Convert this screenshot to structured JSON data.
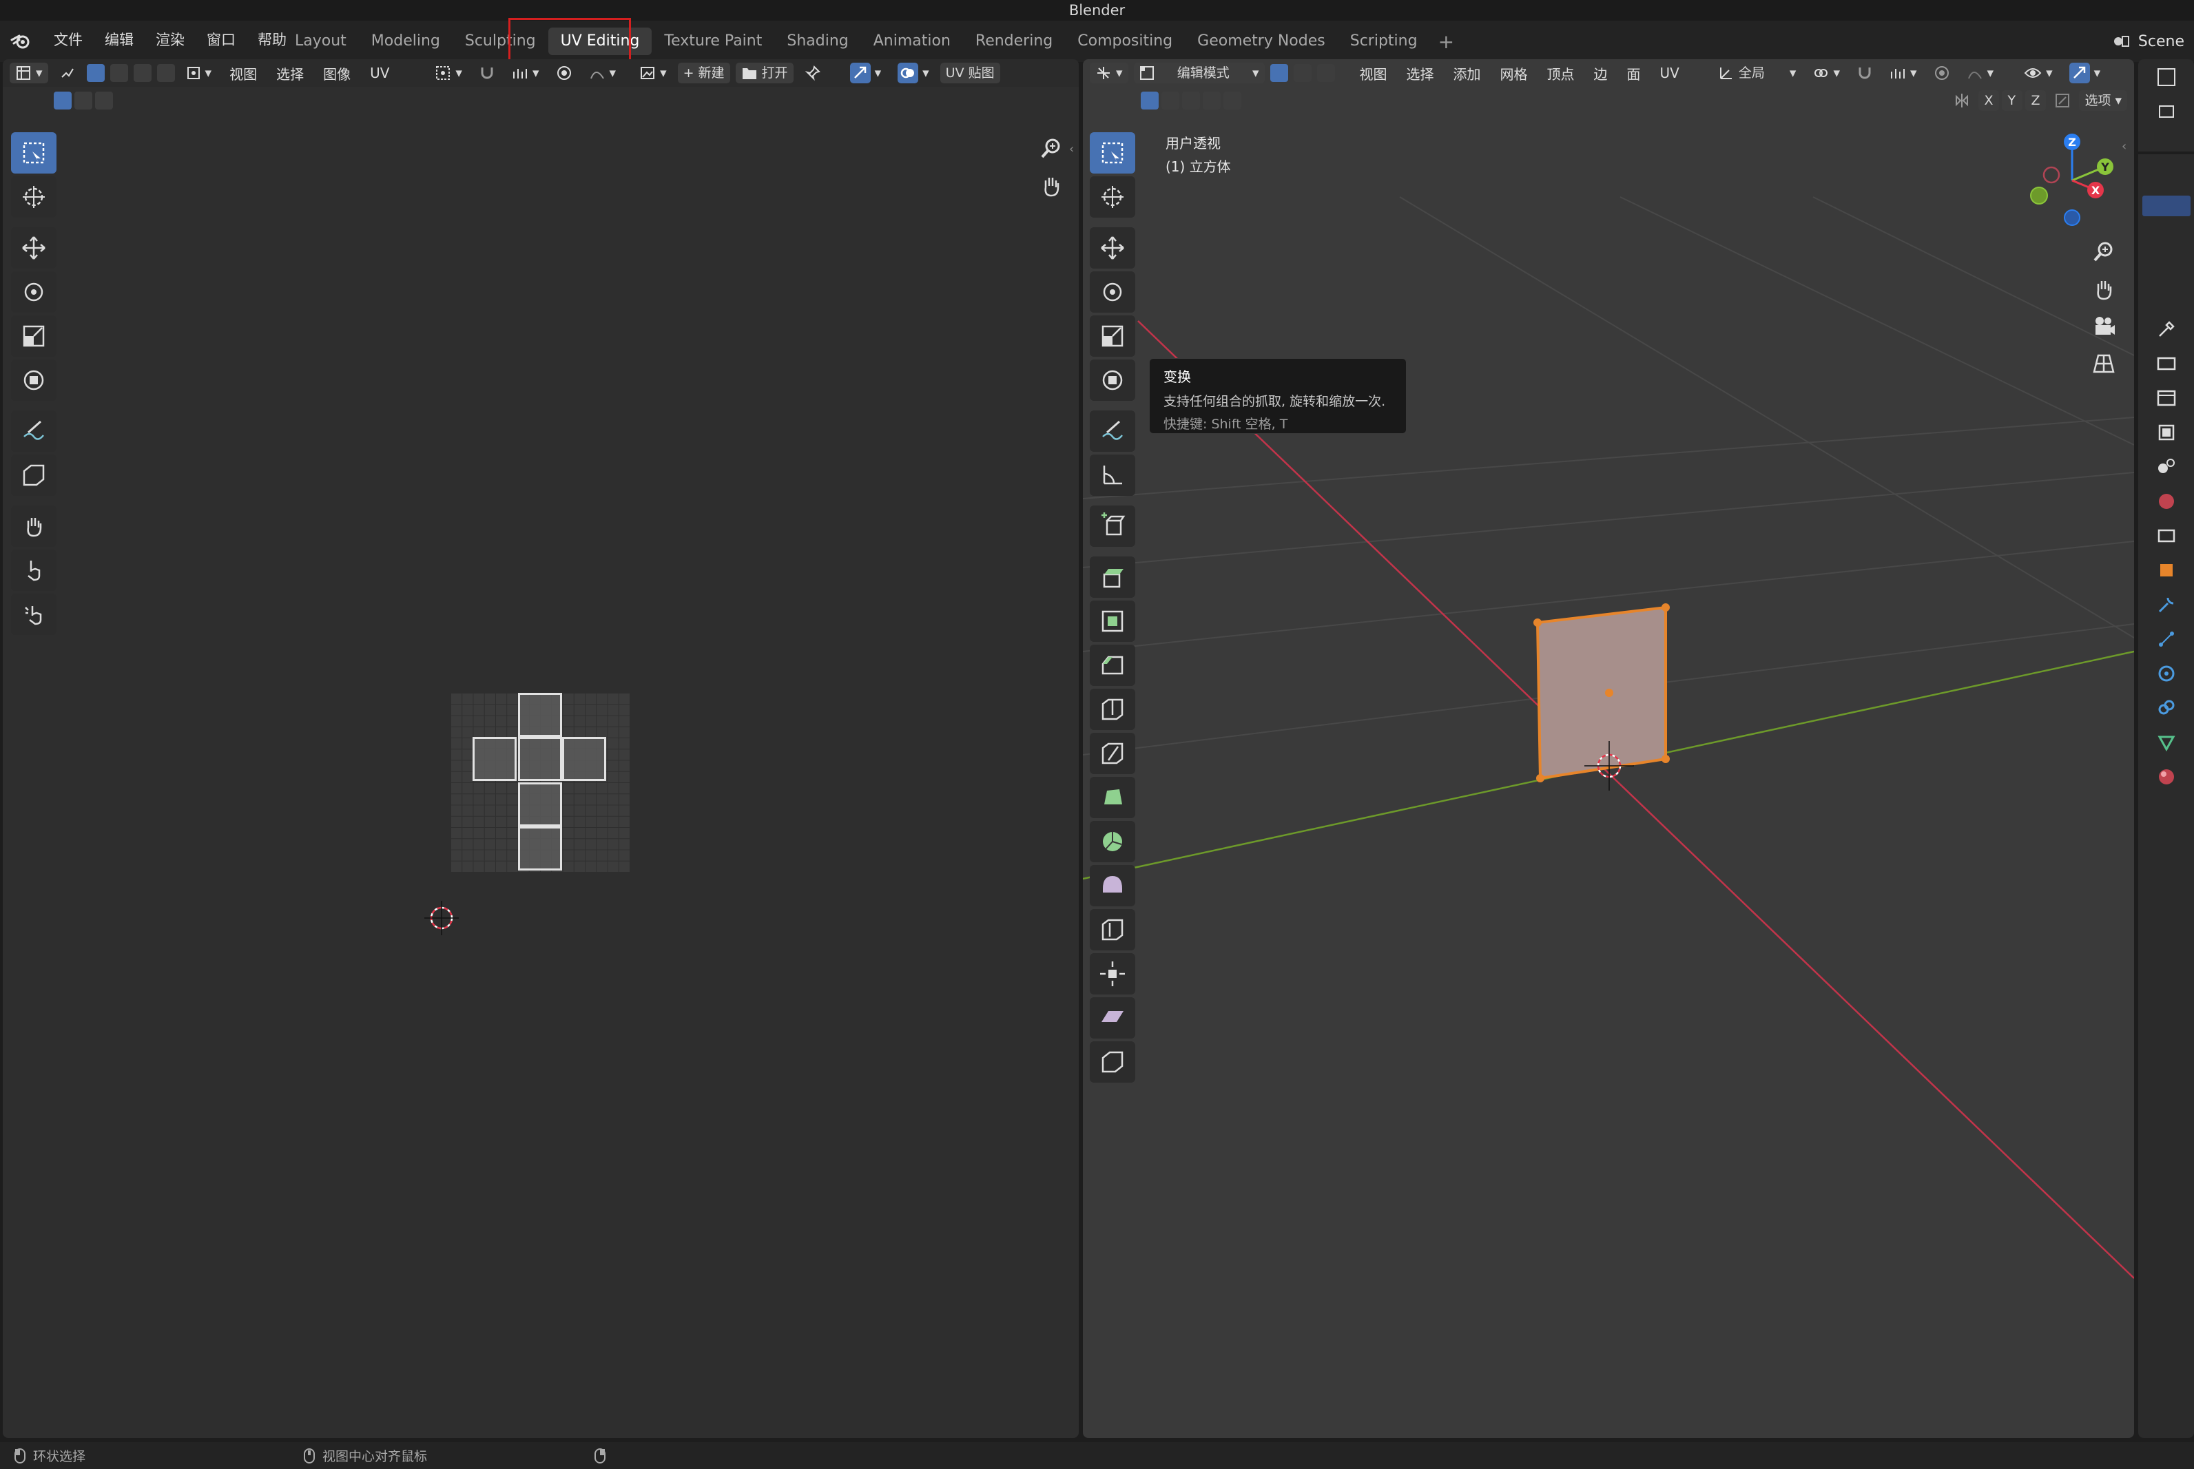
{
  "window": {
    "title": "Blender"
  },
  "menu": [
    {
      "id": "file",
      "label": "文件"
    },
    {
      "id": "edit",
      "label": "编辑"
    },
    {
      "id": "render",
      "label": "渲染"
    },
    {
      "id": "window",
      "label": "窗口"
    },
    {
      "id": "help",
      "label": "帮助"
    }
  ],
  "workspaces": [
    {
      "id": "layout",
      "label": "Layout"
    },
    {
      "id": "modeling",
      "label": "Modeling"
    },
    {
      "id": "sculpting",
      "label": "Sculpting"
    },
    {
      "id": "uv-editing",
      "label": "UV Editing",
      "active": true
    },
    {
      "id": "texture-paint",
      "label": "Texture Paint"
    },
    {
      "id": "shading",
      "label": "Shading"
    },
    {
      "id": "animation",
      "label": "Animation"
    },
    {
      "id": "rendering",
      "label": "Rendering"
    },
    {
      "id": "compositing",
      "label": "Compositing"
    },
    {
      "id": "geometry-nodes",
      "label": "Geometry Nodes"
    },
    {
      "id": "scripting",
      "label": "Scripting"
    }
  ],
  "scene": {
    "label": "Scene"
  },
  "uv_editor": {
    "menus": [
      {
        "id": "view",
        "label": "视图"
      },
      {
        "id": "select",
        "label": "选择"
      },
      {
        "id": "image",
        "label": "图像"
      },
      {
        "id": "uv",
        "label": "UV"
      }
    ],
    "new_label": "新建",
    "open_label": "打开",
    "uvmap_label": "UV 贴图"
  },
  "viewport": {
    "mode_label": "编辑模式",
    "menus": [
      {
        "id": "view",
        "label": "视图"
      },
      {
        "id": "select",
        "label": "选择"
      },
      {
        "id": "add",
        "label": "添加"
      },
      {
        "id": "mesh",
        "label": "网格"
      },
      {
        "id": "vertex",
        "label": "顶点"
      },
      {
        "id": "edge",
        "label": "边"
      },
      {
        "id": "face",
        "label": "面"
      },
      {
        "id": "uv",
        "label": "UV"
      }
    ],
    "orientation_label": "全局",
    "options_label": "选项",
    "axis_x": "X",
    "axis_y": "Y",
    "axis_z": "Z",
    "overlay_title": "用户透视",
    "overlay_object": "(1) 立方体",
    "gizmo": {
      "x": "X",
      "y": "Y",
      "z": "Z"
    }
  },
  "tooltip": {
    "title": "变换",
    "description": "支持任何组合的抓取, 旋转和缩放一次.",
    "shortcut": "快捷键: Shift 空格, T"
  },
  "statusbar": {
    "left": "环状选择",
    "middle": "视图中心对齐鼠标"
  },
  "colors": {
    "accent": "#4772b3",
    "highlight": "#d41f1f",
    "x_axis": "#e5364a",
    "y_axis": "#8ac43a",
    "z_axis": "#2b7ef0",
    "selection": "#e7852b"
  }
}
